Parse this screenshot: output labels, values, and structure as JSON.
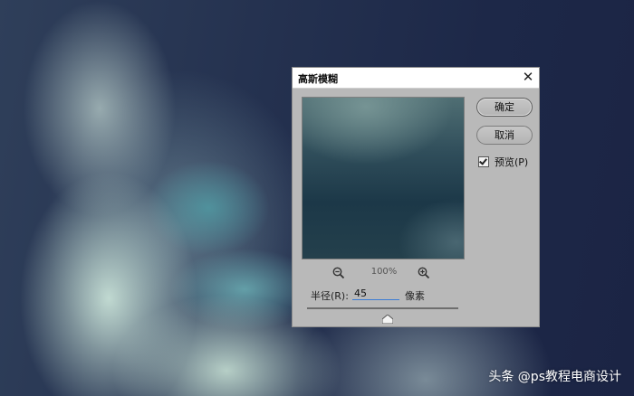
{
  "dialog": {
    "title": "高斯模糊",
    "close_symbol": "✕",
    "ok_label": "确定",
    "cancel_label": "取消",
    "preview_label": "预览(P)",
    "preview_checked": true,
    "zoom_level": "100%",
    "radius_label": "半径(R):",
    "radius_value": "45",
    "radius_unit": "像素",
    "icons": [
      "zoom-out-icon",
      "zoom-in-icon",
      "close-icon",
      "checkbox-icon"
    ]
  },
  "watermark": "头条 @ps教程电商设计",
  "colors": {
    "dialog_bg": "#b9b9b9",
    "titlebar_bg": "#ffffff",
    "input_underline": "#3a7bd5"
  }
}
